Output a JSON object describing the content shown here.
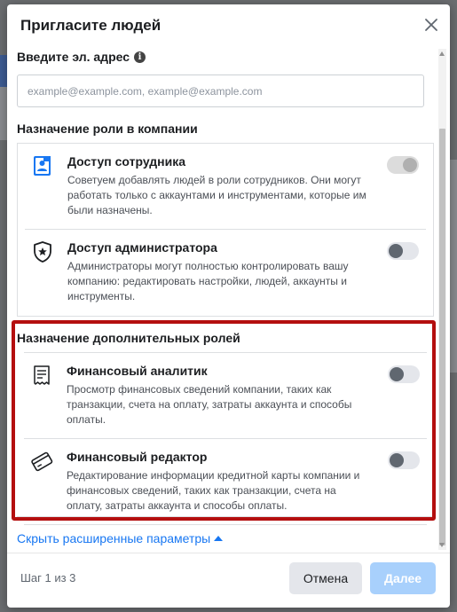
{
  "modal": {
    "title": "Пригласите людей"
  },
  "email": {
    "label": "Введите эл. адрес",
    "placeholder": "example@example.com, example@example.com",
    "value": ""
  },
  "company_roles": {
    "title": "Назначение роли в компании",
    "items": [
      {
        "name": "Доступ сотрудника",
        "description": "Советуем добавлять людей в роли сотрудников. Они могут работать только с аккаунтами и инструментами, которые им были назначены.",
        "icon": "employee-badge-icon",
        "enabled": true,
        "disabled": true
      },
      {
        "name": "Доступ администратора",
        "description": "Администраторы могут полностью контролировать вашу компанию: редактировать настройки, людей, аккаунты и инструменты.",
        "icon": "admin-shield-icon",
        "enabled": false
      }
    ]
  },
  "additional_roles": {
    "title": "Назначение дополнительных ролей",
    "items": [
      {
        "name": "Финансовый аналитик",
        "description": "Просмотр финансовых сведений компании, таких как транзакции, счета на оплату, затраты аккаунта и способы оплаты.",
        "icon": "receipt-icon",
        "enabled": false
      },
      {
        "name": "Финансовый редактор",
        "description": "Редактирование информации кредитной карты компании и финансовых сведений, таких как транзакции, счета на оплату, затраты аккаунта и способы оплаты.",
        "icon": "credit-card-icon",
        "enabled": false
      }
    ]
  },
  "advanced_link": "Скрыть расширенные параметры",
  "footer": {
    "step": "Шаг 1 из 3",
    "cancel_label": "Отмена",
    "next_label": "Далее"
  },
  "colors": {
    "link": "#1877f2",
    "highlight": "#b40f0f",
    "next_disabled": "#a8d0fc"
  }
}
